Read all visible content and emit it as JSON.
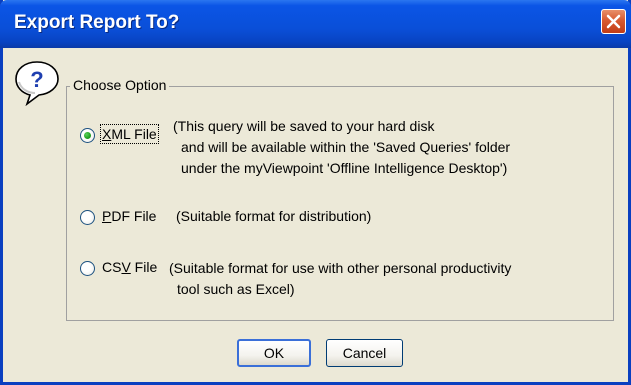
{
  "window": {
    "title": "Export Report To?"
  },
  "group": {
    "legend": "Choose Option"
  },
  "options": [
    {
      "prefix": "",
      "mnemonic": "X",
      "suffix": "ML File",
      "selected": true,
      "description": [
        "(This query will be saved to your hard disk",
        "and will be available within the 'Saved Queries' folder",
        "under the myViewpoint 'Offline Intelligence Desktop')"
      ]
    },
    {
      "prefix": "",
      "mnemonic": "P",
      "suffix": "DF File",
      "selected": false,
      "description": [
        "(Suitable format for distribution)"
      ]
    },
    {
      "prefix": "CS",
      "mnemonic": "V",
      "suffix": " File",
      "selected": false,
      "description": [
        "(Suitable format for use with other personal productivity",
        "tool such as Excel)"
      ]
    }
  ],
  "buttons": {
    "ok": "OK",
    "cancel": "Cancel"
  },
  "icons": {
    "dialog": "help-question-icon",
    "close": "close-icon"
  },
  "colors": {
    "title_bar": "#0a4fd8",
    "window_bg": "#ece9d8",
    "close_button": "#d85a30",
    "radio_selected": "#21a121"
  }
}
